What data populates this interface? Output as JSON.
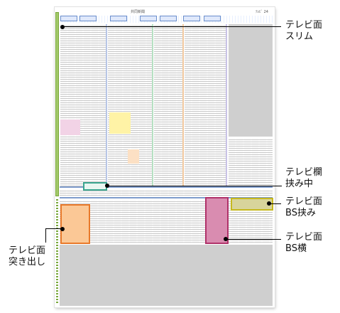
{
  "header": {
    "center_text": "共同新聞",
    "right_text": "ﾃﾚﾋﾞ 24"
  },
  "callouts": {
    "slim": "テレビ面\nスリム",
    "ran_basami": "テレビ欄\n挟み中",
    "bs_basami": "テレビ面\nBS挟み",
    "bs_yoko": "テレビ面\nBS横",
    "tsukidashi": "テレビ面\n突き出し"
  },
  "colors": {
    "slim": "#79a83b",
    "ran_basami": "#3aa58f",
    "bs_basami": "#c6b81e",
    "bs_yoko": "#b0326a",
    "tsukidashi": "#e8792a"
  }
}
